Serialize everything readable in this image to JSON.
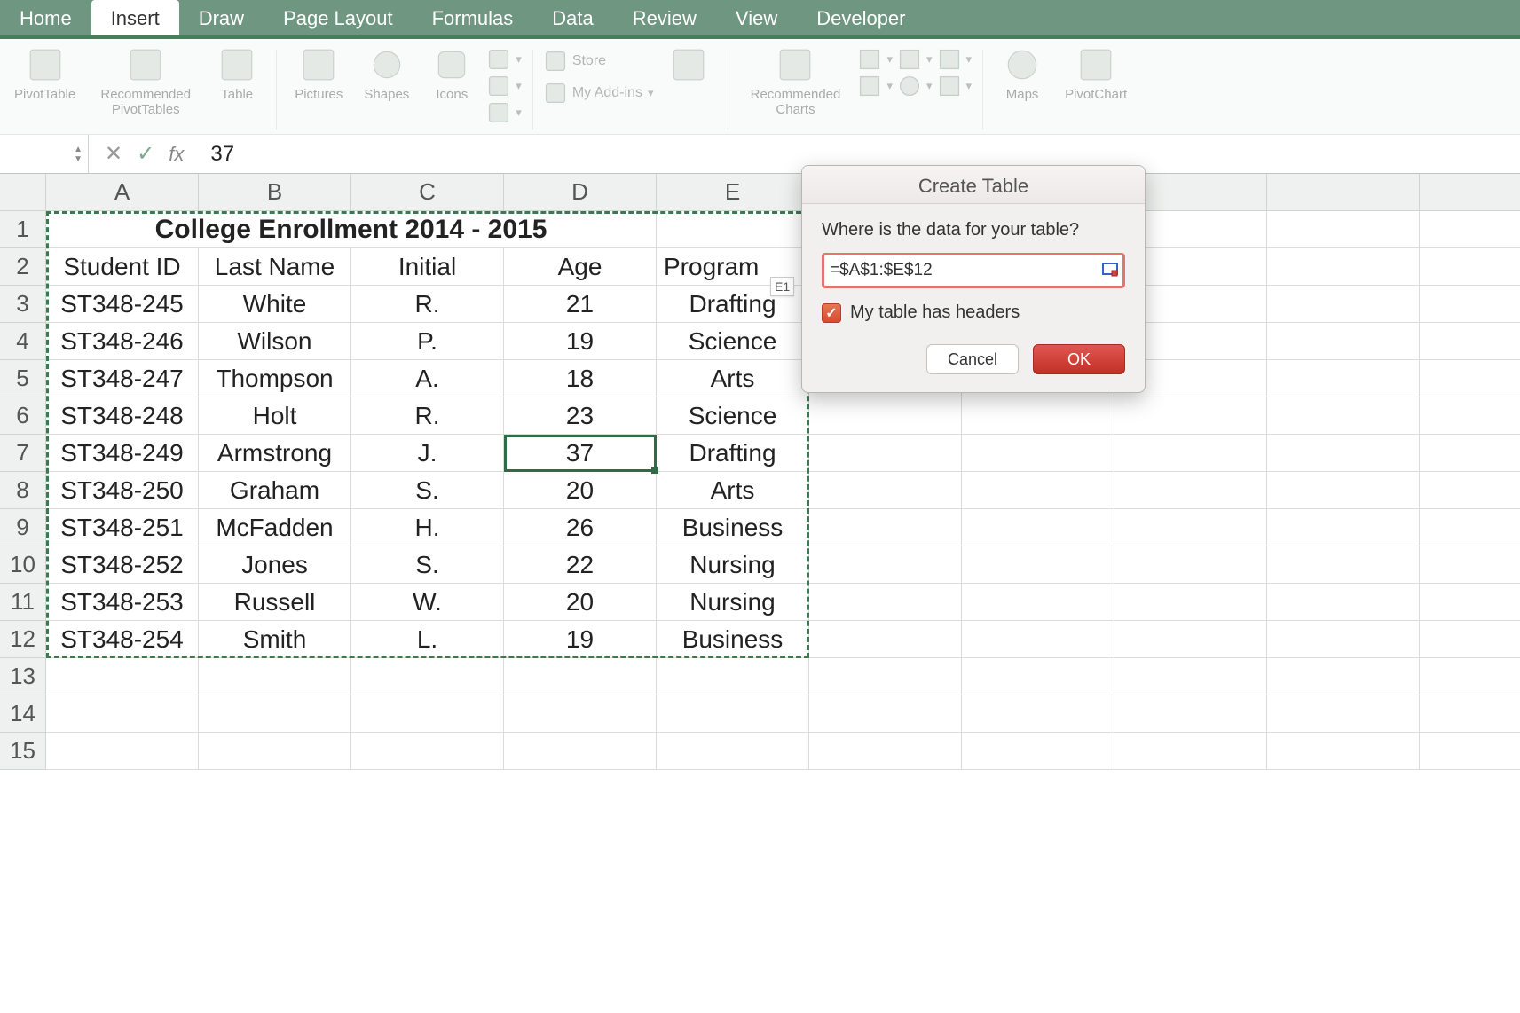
{
  "tabs": [
    "Home",
    "Insert",
    "Draw",
    "Page Layout",
    "Formulas",
    "Data",
    "Review",
    "View",
    "Developer"
  ],
  "active_tab_index": 1,
  "ribbon": {
    "pivot_table": "PivotTable",
    "rec_pivot": "Recommended PivotTables",
    "table": "Table",
    "pictures": "Pictures",
    "shapes": "Shapes",
    "icons": "Icons",
    "store": "Store",
    "addins": "My Add-ins",
    "rec_charts": "Recommended Charts",
    "maps": "Maps",
    "pivot_chart": "PivotChart"
  },
  "formula_bar": {
    "value": "37"
  },
  "columns": [
    "A",
    "B",
    "C",
    "D",
    "E"
  ],
  "row_numbers": [
    1,
    2,
    3,
    4,
    5,
    6,
    7,
    8,
    9,
    10,
    11,
    12,
    13,
    14,
    15
  ],
  "sheet": {
    "title": "College Enrollment 2014 - 2015",
    "headers": [
      "Student ID",
      "Last Name",
      "Initial",
      "Age",
      "Program"
    ],
    "rows": [
      [
        "ST348-245",
        "White",
        "R.",
        "21",
        "Drafting"
      ],
      [
        "ST348-246",
        "Wilson",
        "P.",
        "19",
        "Science"
      ],
      [
        "ST348-247",
        "Thompson",
        "A.",
        "18",
        "Arts"
      ],
      [
        "ST348-248",
        "Holt",
        "R.",
        "23",
        "Science"
      ],
      [
        "ST348-249",
        "Armstrong",
        "J.",
        "37",
        "Drafting"
      ],
      [
        "ST348-250",
        "Graham",
        "S.",
        "20",
        "Arts"
      ],
      [
        "ST348-251",
        "McFadden",
        "H.",
        "26",
        "Business"
      ],
      [
        "ST348-252",
        "Jones",
        "S.",
        "22",
        "Nursing"
      ],
      [
        "ST348-253",
        "Russell",
        "W.",
        "20",
        "Nursing"
      ],
      [
        "ST348-254",
        "Smith",
        "L.",
        "19",
        "Business"
      ]
    ],
    "range_tag": "E1"
  },
  "dialog": {
    "title": "Create Table",
    "prompt": "Where is the data for your table?",
    "range": "=$A$1:$E$12",
    "checkbox_label": "My table has headers",
    "checkbox_checked": true,
    "cancel": "Cancel",
    "ok": "OK"
  }
}
